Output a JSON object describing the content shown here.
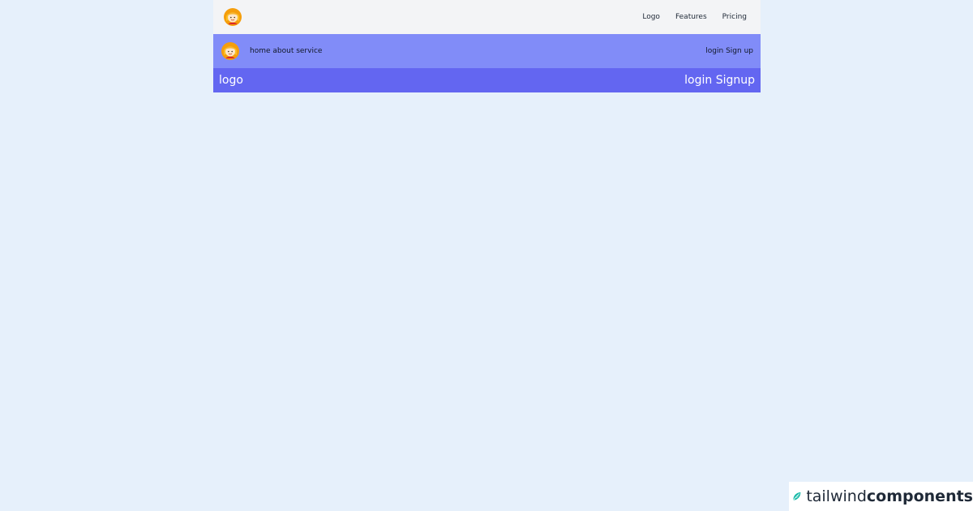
{
  "nav1": {
    "avatar_icon": "woman-avatar-icon",
    "links": [
      "Logo",
      "Features",
      "Pricing"
    ]
  },
  "nav2": {
    "avatar_icon": "woman-avatar-icon",
    "menu": "home about service",
    "auth": "login Sign up"
  },
  "nav3": {
    "logo": "logo",
    "auth": "login Signup"
  },
  "watermark": {
    "icon": "leaf-logo-icon",
    "prefix": "tailwind",
    "suffix": "components"
  },
  "colors": {
    "page_bg": "#e6f0fb",
    "nav1_bg": "#f3f4f6",
    "nav2_bg": "#818cf8",
    "nav3_bg": "#6366f1",
    "brand_accent": "#14b8a6"
  }
}
